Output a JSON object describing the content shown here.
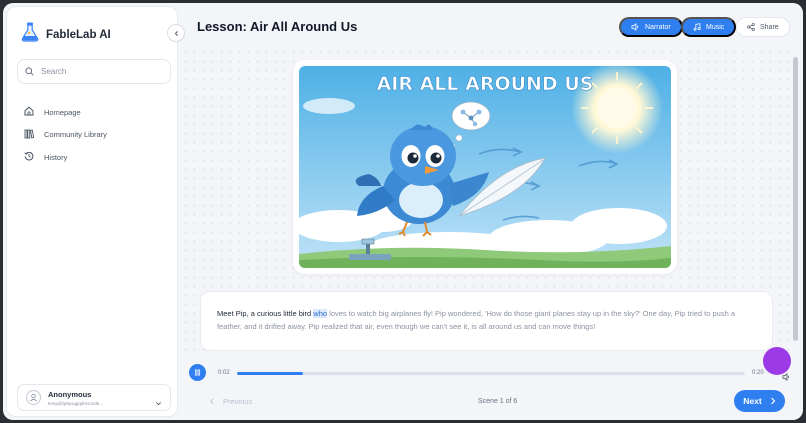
{
  "app": {
    "title": "FableLab AI"
  },
  "sidebar": {
    "search_placeholder": "Search",
    "items": [
      {
        "label": "Homepage",
        "icon": "home-icon"
      },
      {
        "label": "Community Library",
        "icon": "library-icon"
      },
      {
        "label": "History",
        "icon": "history-icon"
      }
    ],
    "user": {
      "name": "Anonymous",
      "email": "temp@tp9yxqgqdmsonde..."
    }
  },
  "header": {
    "title": "Lesson: Air All Around Us",
    "narrator_label": "Narrator",
    "music_label": "Music",
    "share_label": "Share"
  },
  "illustration": {
    "heading": "AIR ALL AROUND US"
  },
  "story": {
    "read_text": "Meet Pip, a curious little bird ",
    "highlight_word": "who",
    "unread_text": " loves to watch big airplanes fly! Pip wondered, 'How do those giant planes stay up in the sky?' One day, Pip tried to push a feather, and it drifted away. Pip realized that air, even though we can't see it, is all around us and can move things!"
  },
  "player": {
    "current": "0:02",
    "total": "0:20",
    "progress": 0.13
  },
  "footer": {
    "prev_label": "Previous",
    "scene_label": "Scene 1 of 6",
    "next_label": "Next"
  },
  "colors": {
    "accent": "#2f7ff0",
    "fab": "#9b3ae6"
  }
}
